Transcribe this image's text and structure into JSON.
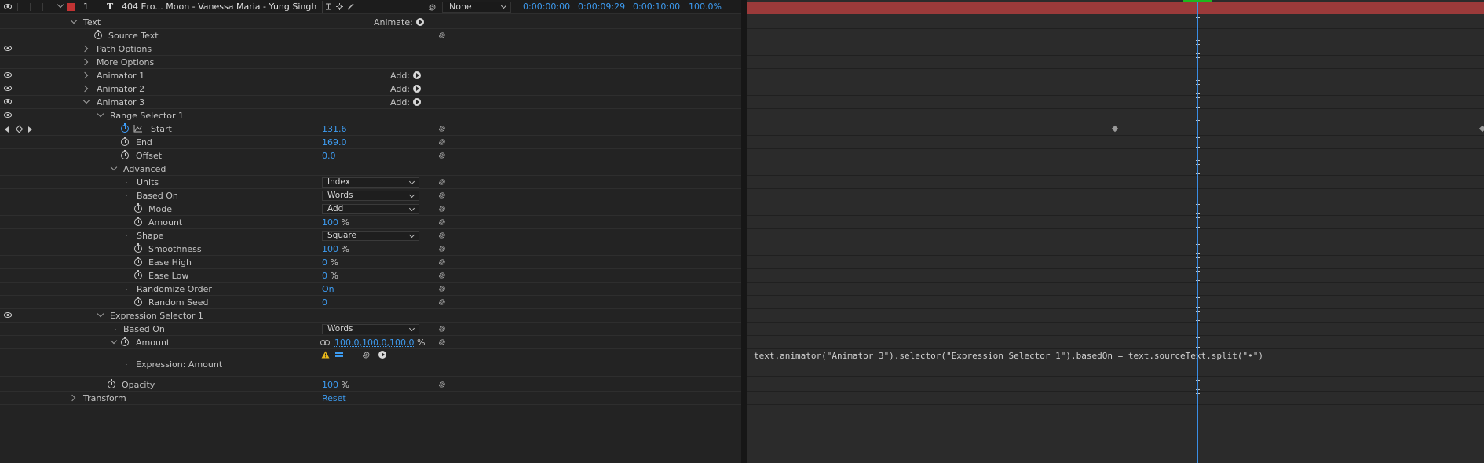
{
  "layer": {
    "number": "1",
    "type_icon": "T",
    "name": "404 Ero... Moon - Vanessa Maria - Yung Singh",
    "parent": "None",
    "in_time": "0:00:00:00",
    "out_time": "0:00:09:29",
    "duration": "0:00:10:00",
    "stretch": "100.0%",
    "label_color": "#c13333"
  },
  "props": {
    "text": "Text",
    "animate_label": "Animate:",
    "source_text": "Source Text",
    "path_options": "Path Options",
    "more_options": "More Options",
    "animator1": "Animator 1",
    "animator2": "Animator 2",
    "animator3": "Animator 3",
    "add_label": "Add:",
    "range_selector": "Range Selector 1",
    "start": "Start",
    "start_val": "131.6",
    "end": "End",
    "end_val": "169.0",
    "offset": "Offset",
    "offset_val": "0.0",
    "advanced": "Advanced",
    "units": "Units",
    "units_val": "Index",
    "based_on": "Based On",
    "based_on_val": "Words",
    "mode": "Mode",
    "mode_val": "Add",
    "amount": "Amount",
    "amount_val": "100",
    "pct": "%",
    "shape": "Shape",
    "shape_val": "Square",
    "smoothness": "Smoothness",
    "smoothness_val": "100",
    "ease_high": "Ease High",
    "ease_high_val": "0",
    "ease_low": "Ease Low",
    "ease_low_val": "0",
    "randomize": "Randomize Order",
    "randomize_val": "On",
    "random_seed": "Random Seed",
    "random_seed_val": "0",
    "expr_selector": "Expression Selector 1",
    "expr_based_on": "Based On",
    "expr_based_on_val": "Words",
    "expr_amount": "Amount",
    "expr_amount_val": "100.0,100.0,100.0",
    "expr_label": "Expression: Amount",
    "opacity": "Opacity",
    "opacity_val": "100",
    "transform": "Transform",
    "reset": "Reset"
  },
  "expression_text": "text.animator(\"Animator 3\").selector(\"Expression Selector 1\").basedOn = text.sourceText.split(\"•\")",
  "colors": {
    "accent_blue": "#3d9bf0",
    "cti_blue": "#3a8ee6",
    "cti_green": "#1db81d",
    "layer_bar": "#9b3a3a"
  }
}
